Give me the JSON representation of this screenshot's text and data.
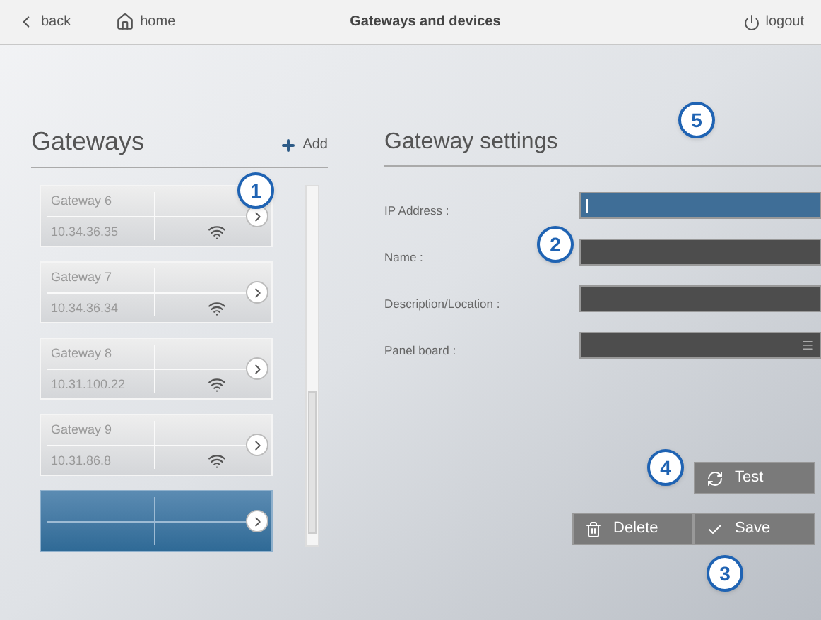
{
  "header": {
    "back": "back",
    "home": "home",
    "title": "Gateways and devices",
    "logout": "logout"
  },
  "gateways": {
    "title": "Gateways",
    "add": "Add",
    "items": [
      {
        "name": "Gateway 6",
        "ip": "10.34.36.35",
        "selected": false
      },
      {
        "name": "Gateway 7",
        "ip": "10.34.36.34",
        "selected": false
      },
      {
        "name": "Gateway 8",
        "ip": "10.31.100.22",
        "selected": false
      },
      {
        "name": "Gateway 9",
        "ip": "10.31.86.8",
        "selected": false
      },
      {
        "selected": true
      }
    ]
  },
  "settings": {
    "title": "Gateway settings",
    "fields": [
      {
        "label": "IP Address :",
        "kind": "text",
        "focused": true
      },
      {
        "label": "Name :",
        "kind": "text",
        "focused": false
      },
      {
        "label": "Description/Location :",
        "kind": "text",
        "focused": false
      },
      {
        "label": "Panel board :",
        "kind": "select",
        "focused": false
      }
    ],
    "buttons": [
      {
        "label": "Test",
        "kind": "test"
      },
      {
        "label": "Delete",
        "kind": "delete"
      },
      {
        "label": "Save",
        "kind": "save"
      }
    ]
  },
  "callouts": [
    "1",
    "2",
    "3",
    "4",
    "5"
  ]
}
